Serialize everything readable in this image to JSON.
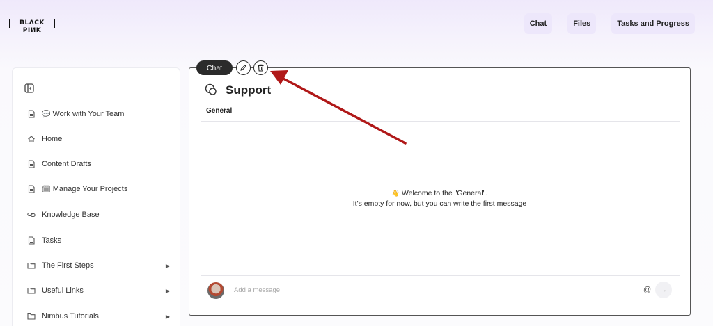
{
  "header": {
    "logo_text": "BLACKPINK",
    "nav": [
      {
        "label": "Chat"
      },
      {
        "label": "Files"
      },
      {
        "label": "Tasks and Progress"
      }
    ]
  },
  "sidebar": {
    "items": [
      {
        "label": "Work with Your Team",
        "icon": "page-icon",
        "emoji": "💬",
        "has_children": false
      },
      {
        "label": "Home",
        "icon": "home-icon",
        "has_children": false
      },
      {
        "label": "Content Drafts",
        "icon": "page-icon",
        "has_children": false
      },
      {
        "label": "Manage Your Projects",
        "icon": "page-icon",
        "emoji": "🗓",
        "has_children": false
      },
      {
        "label": "Knowledge Base",
        "icon": "link-icon",
        "has_children": false
      },
      {
        "label": "Tasks",
        "icon": "page-icon",
        "has_children": false
      },
      {
        "label": "The First Steps",
        "icon": "folder-icon",
        "has_children": true
      },
      {
        "label": "Useful Links",
        "icon": "folder-icon",
        "has_children": true
      },
      {
        "label": "Nimbus Tutorials",
        "icon": "folder-icon",
        "has_children": true
      }
    ]
  },
  "chat_block": {
    "label": "Chat",
    "actions": [
      "edit-icon",
      "trash-icon"
    ]
  },
  "panel": {
    "title": "Support",
    "channel_tab": "General",
    "welcome_line1": "Welcome to the \"General\".",
    "welcome_line2": "It's empty for now, but you can write the first message",
    "composer_placeholder": "Add a message",
    "mention_symbol": "@",
    "send_glyph": "→"
  },
  "colors": {
    "accent_bg": "#ede7fb",
    "annotation_arrow": "#b01818"
  }
}
